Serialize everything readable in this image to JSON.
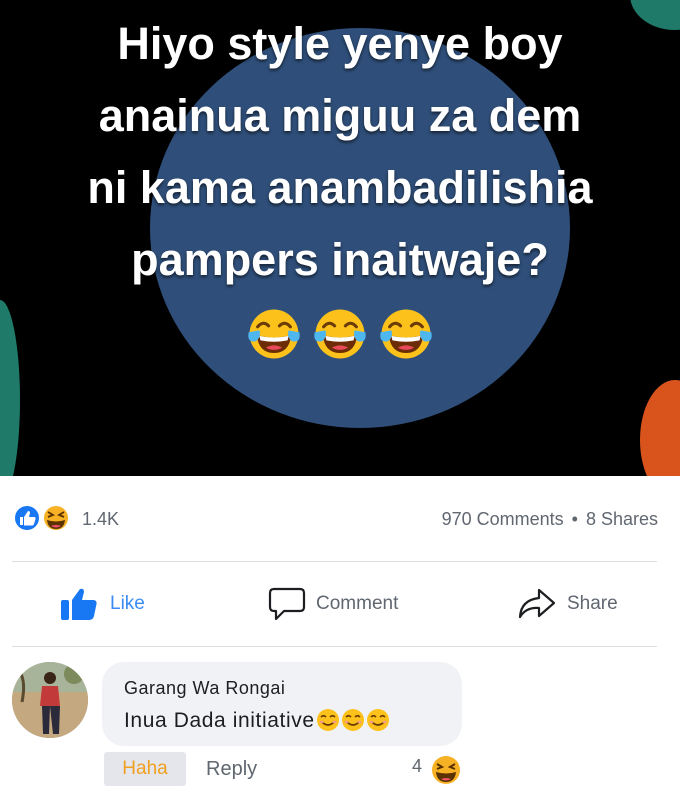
{
  "post": {
    "meme_lines": [
      "Hiyo style yenye boy",
      "anainua miguu za dem",
      "ni kama anambadilishia",
      "pampers inaitwaje?"
    ],
    "meme_emojis": [
      "face-with-tears-of-joy",
      "face-with-tears-of-joy",
      "face-with-tears-of-joy"
    ]
  },
  "stats": {
    "reaction_icons": [
      "like-icon",
      "haha-icon"
    ],
    "reaction_count": "1.4K",
    "comments": "970 Comments",
    "separator": "•",
    "shares": "8 Shares"
  },
  "actions": {
    "like_label": "Like",
    "comment_label": "Comment",
    "share_label": "Share"
  },
  "comment": {
    "author": "Garang Wa Rongai",
    "text": "Inua Dada initiative",
    "text_emojis": [
      "smiling-face",
      "smiling-face",
      "smiling-face"
    ],
    "haha_label": "Haha",
    "reply_label": "Reply",
    "reaction_count": "4",
    "reaction_icon": "haha-icon"
  },
  "colors": {
    "facebook_blue": "#1877f2",
    "haha_yellow": "#f7b125",
    "text_gray": "#606770",
    "bubble_bg": "#f0f2f5"
  }
}
